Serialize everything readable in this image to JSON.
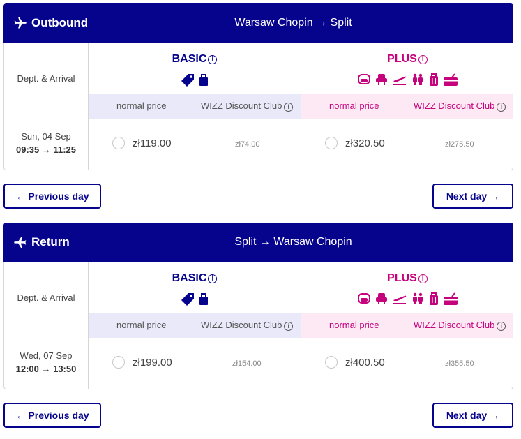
{
  "colors": {
    "brand": "#06038d",
    "basic": "#06038d",
    "plus": "#c5037d"
  },
  "columns": {
    "dept_arrival": "Dept. & Arrival",
    "basic": "BASIC",
    "plus": "PLUS",
    "normal_price": "normal price",
    "discount_club": "WIZZ Discount Club"
  },
  "outbound": {
    "label": "Outbound",
    "route": "Warsaw Chopin → Split",
    "date": "Sun, 04 Sep",
    "time": "09:35 → 11:25",
    "basic_price": "zł119.00",
    "basic_discount": "zł74.00",
    "plus_price": "zł320.50",
    "plus_discount": "zł275.50",
    "prev_day": "Previous day",
    "next_day": "Next day"
  },
  "return": {
    "label": "Return",
    "route": "Split → Warsaw Chopin",
    "date": "Wed, 07 Sep",
    "time": "12:00 → 13:50",
    "basic_price": "zł199.00",
    "basic_discount": "zł154.00",
    "plus_price": "zł400.50",
    "plus_discount": "zł355.50",
    "prev_day": "Previous day",
    "next_day": "Next day"
  },
  "icons": {
    "basic": [
      "tag-icon",
      "bag-icon"
    ],
    "plus": [
      "seat-icon",
      "seat-select-icon",
      "plane-takeoff-icon",
      "priority-icon",
      "luggage-icon",
      "cabin-bag-icon"
    ]
  }
}
